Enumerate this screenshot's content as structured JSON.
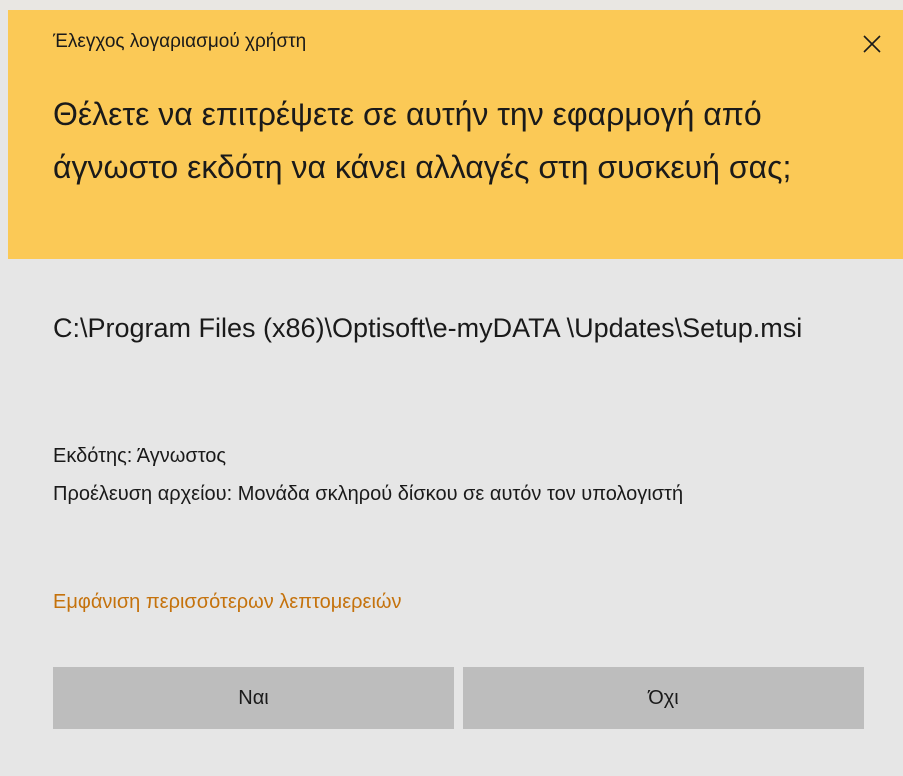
{
  "window": {
    "title": "Έλεγχος λογαριασμού χρήστη",
    "close_icon": "close-icon",
    "header_color": "#fbc956",
    "body_color": "#e6e6e6"
  },
  "prompt": {
    "question": "Θέλετε να επιτρέψετε σε αυτήν την εφαρμογή από άγνωστο εκδότη να κάνει αλλαγές στη συσκευή σας;"
  },
  "program": {
    "path": "C:\\Program Files (x86)\\Optisoft\\e-myDATA \\Updates\\Setup.msi"
  },
  "info": {
    "publisher": "Εκδότης: Άγνωστος",
    "file_origin": "Προέλευση αρχείου: Μονάδα σκληρού δίσκου σε αυτόν τον υπολογιστή"
  },
  "details_link": {
    "label": "Εμφάνιση περισσότερων λεπτομερειών",
    "color": "#c5720c"
  },
  "buttons": {
    "yes_label": "Ναι",
    "no_label": "Όχι",
    "color": "#bdbdbd"
  }
}
